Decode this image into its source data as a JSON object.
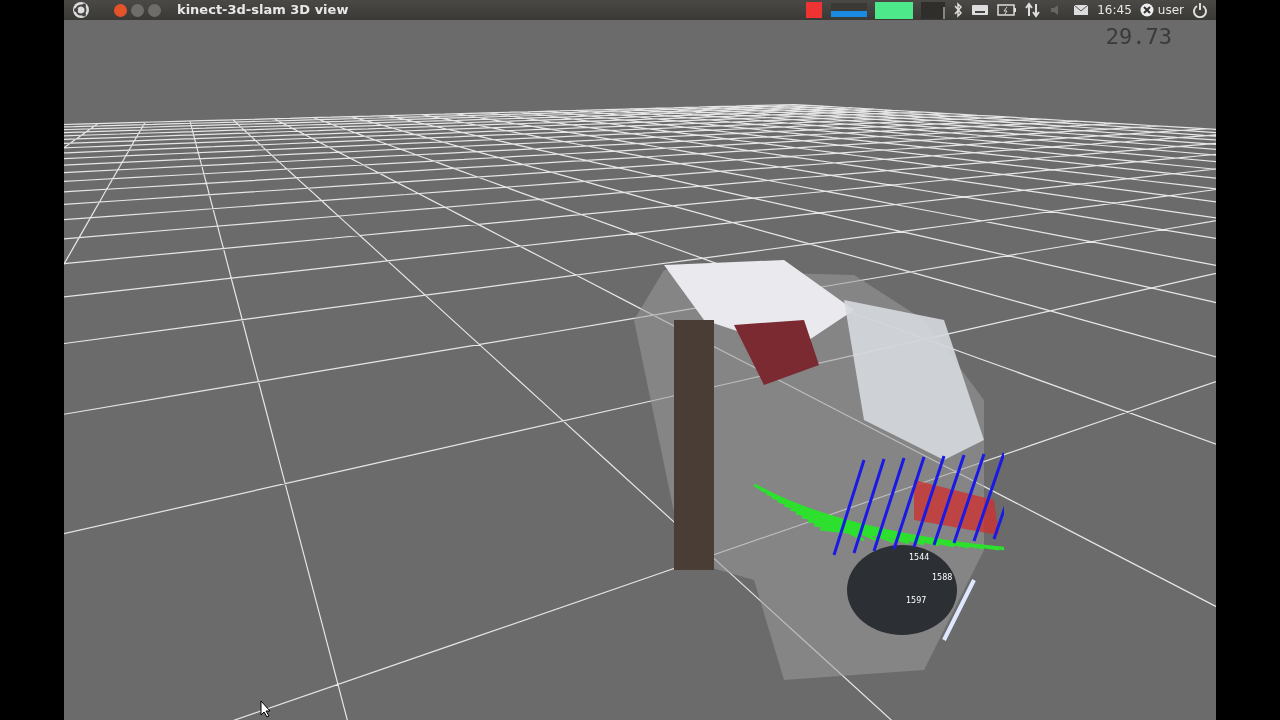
{
  "window": {
    "title": "kinect-3d-slam 3D view"
  },
  "panel": {
    "clock": "16:45",
    "user": "user"
  },
  "viewport": {
    "fps": "29.73",
    "node_labels": [
      {
        "text": "1544"
      },
      {
        "text": "1588"
      },
      {
        "text": "1597"
      }
    ]
  }
}
